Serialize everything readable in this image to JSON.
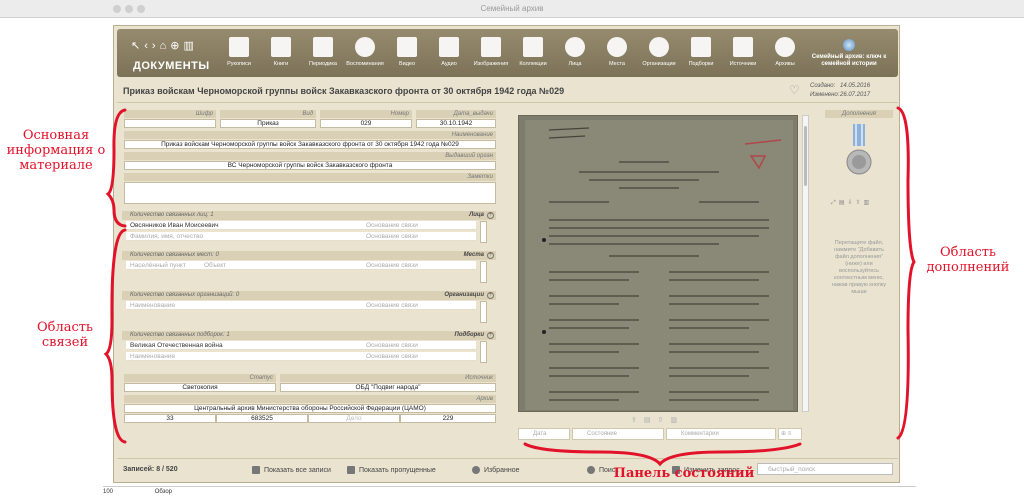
{
  "window": {
    "title": "Семейный архив"
  },
  "toolbar": {
    "section_title": "ДОКУМЕНТЫ",
    "tools": [
      "Рукописи",
      "Книги",
      "Периодика",
      "Воспоминания",
      "Видео",
      "Аудио",
      "Изображения",
      "Коллекции",
      "Лица",
      "Места",
      "Организации",
      "Подборки",
      "Источники",
      "Архивы"
    ],
    "brand": "Семейный архив: ключ к семейной истории"
  },
  "record": {
    "title": "Приказ войскам Черноморской группы войск Закавказского фронта от 30 октября 1942 года №029",
    "created_label": "Создано:",
    "created": "14.05.2016",
    "modified_label": "Изменено:",
    "modified": "26.07.2017"
  },
  "main": {
    "cipher_label": "Шифр",
    "type_label": "Вид",
    "type": "Приказ",
    "number_label": "Номер",
    "number": "029",
    "date_label": "Дата_выдачи",
    "date": "30.10.1942",
    "name_label": "Наименование",
    "name": "Приказ войскам Черноморской группы войск Закавказского фронта от 30 октября 1942 года №029",
    "issuer_label": "Выдавший орган",
    "issuer": "ВС Черноморской группы войск Закавказского фронта",
    "notes_label": "Заметки"
  },
  "links": {
    "persons": {
      "count_label": "Количество связанных лиц:",
      "count": "1",
      "title": "Лица",
      "rows": [
        "Овсянников Иван Моисеевич"
      ],
      "basis": "Основание связи",
      "placeholder": "Фамилия, имя, отчество"
    },
    "places": {
      "count_label": "Количество связанных мест:",
      "count": "0",
      "title": "Места",
      "placeholder": "Населённый пункт",
      "object": "Объект",
      "basis": "Основание связи"
    },
    "orgs": {
      "count_label": "Количество связанных организаций:",
      "count": "0",
      "title": "Организации",
      "placeholder": "Наименование",
      "basis": "Основание связи"
    },
    "sets": {
      "count_label": "Количество связанных подборок:",
      "count": "1",
      "title": "Подборки",
      "rows": [
        "Великая Отечественная война"
      ],
      "placeholder": "Наименование",
      "basis": "Основание связи"
    }
  },
  "status": {
    "status_label": "Статус",
    "status": "Светокопия",
    "source_label": "Источник",
    "source": "ОБД \"Подвиг народа\""
  },
  "archive": {
    "label": "Архив",
    "name": "Центральный архив Министерства обороны Российской Федерации (ЦАМО)",
    "fund": "33",
    "inventory": "683525",
    "case_label": "Дело",
    "page": "229"
  },
  "state_panel": {
    "date": "Дата",
    "state": "Состояние",
    "comments": "Комментарии"
  },
  "supplements": {
    "title": "Дополнения",
    "hint": "Перетащите файл, нажмите \"Добавить файл дополнения\" (ниже) или воспользуйтесь контекстным меню, нажав правую кнопку мыши"
  },
  "footer": {
    "records_label": "Записей:",
    "records": "8 / 520",
    "show_all": "Показать все записи",
    "show_skipped": "Показать пропущенные",
    "favorites": "Избранное",
    "search": "Поиск",
    "change_query": "Изменить запрос",
    "quick_search": "быстрый_поиск"
  },
  "statusbar": {
    "zoom": "100",
    "mode": "Обзор"
  },
  "annotations": {
    "main_info": "Основная информация о материале",
    "links_area": "Область связей",
    "supplements_area": "Область дополнений",
    "state_panel": "Панель состояний"
  },
  "colors": {
    "accent": "#e2122a",
    "toolbar": "#8a7f63",
    "panel": "#e9e3d0"
  }
}
